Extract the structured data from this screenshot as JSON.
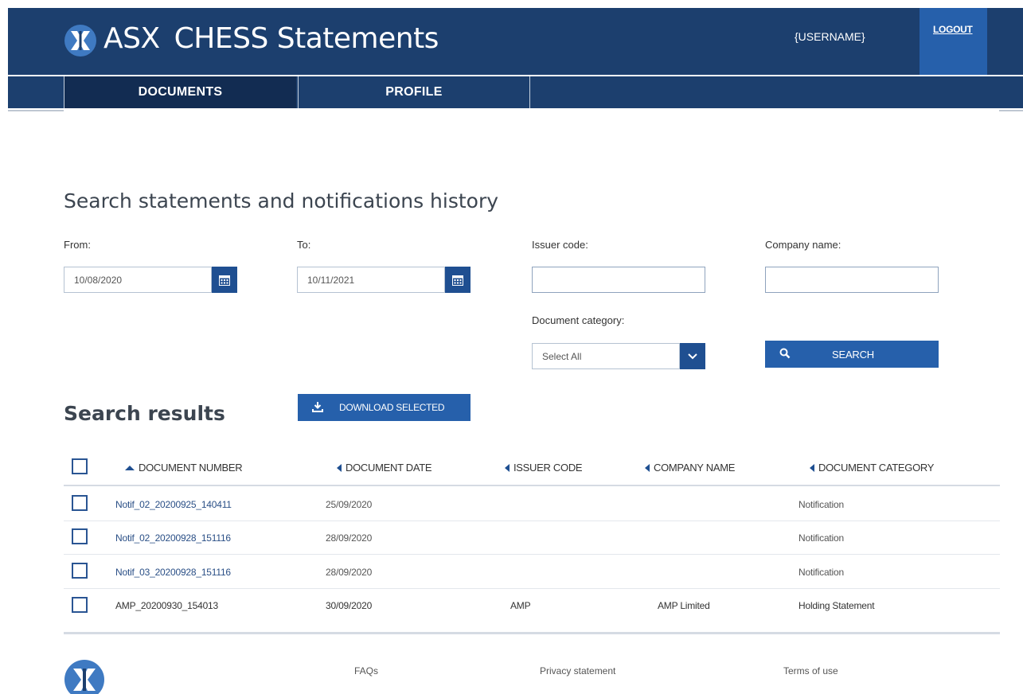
{
  "header": {
    "brand": "ASX",
    "title": "CHESS Statements",
    "username": "{USERNAME}",
    "logout_label": "LOGOUT",
    "colors": {
      "header_bg": "#1c3f6e",
      "accent": "#2660ab"
    }
  },
  "nav": {
    "tabs": [
      {
        "label": "DOCUMENTS",
        "active": true
      },
      {
        "label": "PROFILE",
        "active": false
      }
    ]
  },
  "search": {
    "title": "Search statements and notifications history",
    "from_label": "From:",
    "from_value": "10/08/2020",
    "to_label": "To:",
    "to_value": "10/11/2021",
    "issuer_label": "Issuer code:",
    "issuer_value": "",
    "company_label": "Company name:",
    "company_value": "",
    "category_label": "Document category:",
    "category_value": "Select All",
    "search_label": "SEARCH"
  },
  "results": {
    "title": "Search results",
    "download_label": "DOWNLOAD SELECTED",
    "columns": [
      "DOCUMENT NUMBER",
      "DOCUMENT DATE",
      "ISSUER CODE",
      "COMPANY NAME",
      "DOCUMENT CATEGORY"
    ],
    "sort_column": "DOCUMENT NUMBER",
    "rows": [
      {
        "number": "Notif_02_20200925_140411",
        "date": "25/09/2020",
        "issuer": "",
        "company": "",
        "category": "Notification"
      },
      {
        "number": "Notif_02_20200928_151116",
        "date": "28/09/2020",
        "issuer": "",
        "company": "",
        "category": "Notification"
      },
      {
        "number": "Notif_03_20200928_151116",
        "date": "28/09/2020",
        "issuer": "",
        "company": "",
        "category": "Notification"
      },
      {
        "number": "AMP_20200930_154013",
        "date": "30/09/2020",
        "issuer": "AMP",
        "company": "AMP Limited",
        "category": "Holding Statement"
      }
    ]
  },
  "footer": {
    "links": [
      "FAQs",
      "Privacy statement",
      "Terms of use"
    ]
  }
}
